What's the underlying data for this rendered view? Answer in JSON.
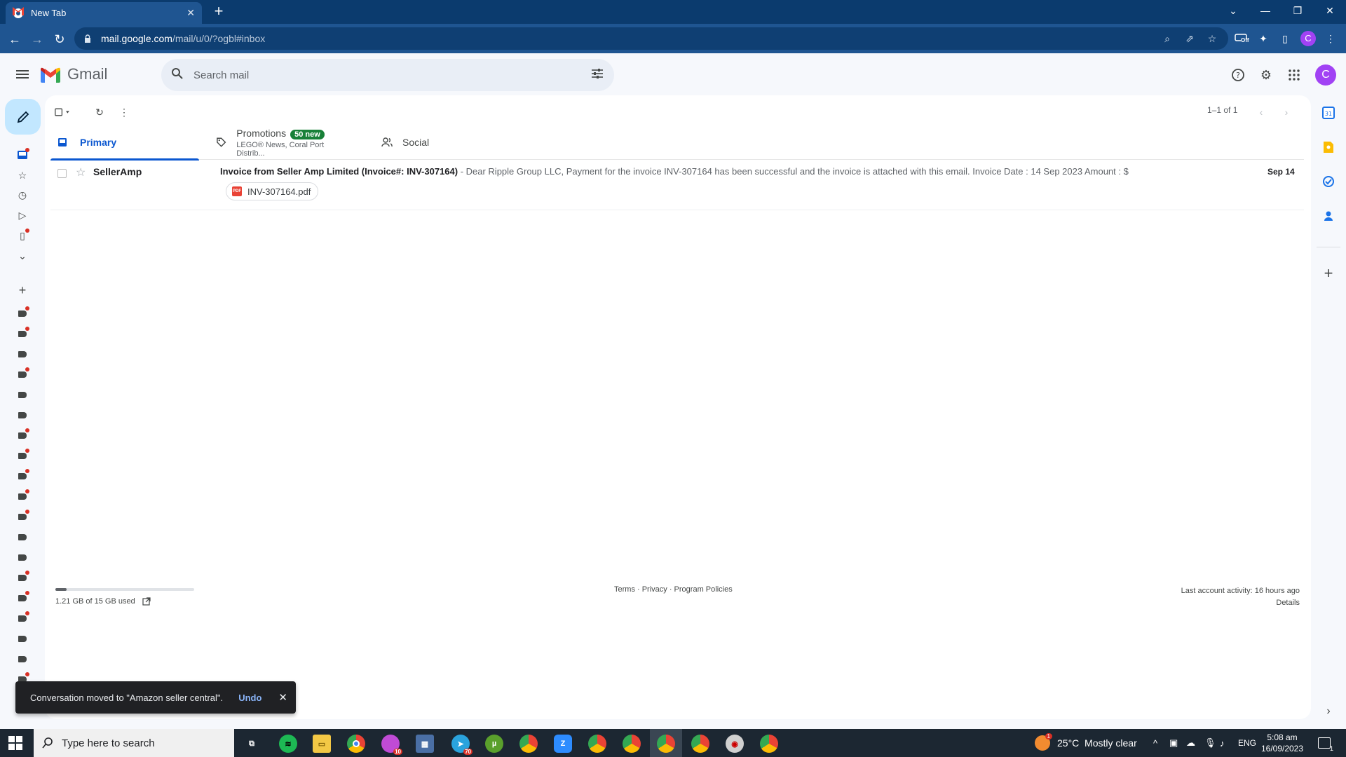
{
  "browser": {
    "tab_title": "New Tab",
    "url_host": "mail.google.com",
    "url_path": "/mail/u/0/?ogbl#inbox",
    "profile_initial": "C",
    "extension_badge": "Off"
  },
  "gmail": {
    "logo_text": "Gmail",
    "search_placeholder": "Search mail",
    "avatar_initial": "C"
  },
  "toolbar": {
    "pager": "1–1 of 1"
  },
  "tabs": {
    "primary": "Primary",
    "promotions": "Promotions",
    "promotions_badge": "50 new",
    "promotions_sub": "LEGO® News, Coral Port Distrib...",
    "social": "Social"
  },
  "email": {
    "sender": "SellerAmp",
    "subject": "Invoice from Seller Amp Limited (Invoice#: INV-307164)",
    "snippet": " - Dear Ripple Group LLC, Payment for the invoice INV-307164 has been successful and the invoice is attached with this email. Invoice Date : 14 Sep 2023 Amount : $",
    "date": "Sep 14",
    "attachment": "INV-307164.pdf",
    "attachment_icon_text": "PDF"
  },
  "footer": {
    "storage": "1.21 GB of 15 GB used",
    "storage_fraction": 0.081,
    "links": "Terms · Privacy · Program Policies",
    "activity": "Last account activity: 16 hours ago",
    "details": "Details"
  },
  "snackbar": {
    "message": "Conversation moved to \"Amazon seller central\".",
    "undo": "Undo"
  },
  "taskbar": {
    "search_placeholder": "Type here to search",
    "weather": "25°C  Mostly clear",
    "weather_badge": "1",
    "lang": "ENG",
    "time": "5:08 am",
    "date": "16/09/2023",
    "notif_count": "1",
    "app_badges": {
      "chat": "10",
      "telegram": "70"
    }
  },
  "colors": {
    "accent": "#0b57d0",
    "compose_bg": "#c2e7ff",
    "badge_green": "#188038",
    "unread_dot": "#d93025",
    "browser_frame": "#0b3b6e"
  }
}
